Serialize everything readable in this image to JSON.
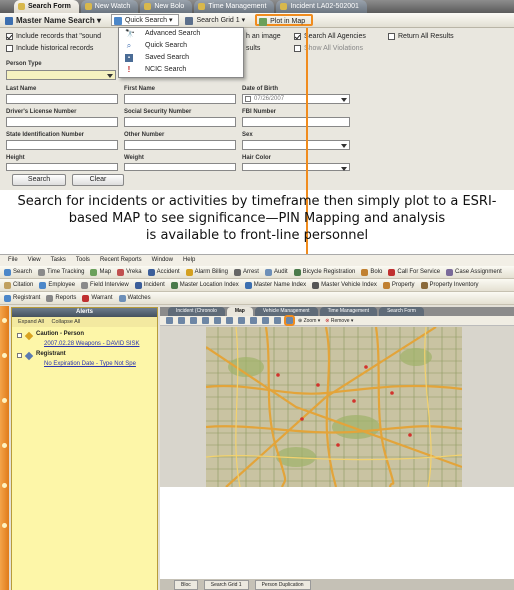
{
  "top": {
    "tabs": [
      {
        "label": "Search Form"
      },
      {
        "label": "New Watch"
      },
      {
        "label": "New Bolo"
      },
      {
        "label": "Time Management"
      },
      {
        "label": "Incident LA02-502001"
      }
    ],
    "toolbar": {
      "master_name_search": "Master Name Search",
      "quick_search": "Quick Search",
      "search_grid": "Search Grid 1",
      "plot_in_map": "Plot in Map"
    },
    "options": {
      "include_records_sound": "Include records that \"sound",
      "include_historical": "Include historical records",
      "with_image_partial": "h an image",
      "results_partial": "sults",
      "search_all_agencies": "Search All Agencies",
      "return_all_results": "Return All Results",
      "show_all_violations": "Show All Violations"
    },
    "quick_search_menu": [
      {
        "label": "Advanced Search",
        "icon": "binoculars-icon"
      },
      {
        "label": "Quick Search",
        "icon": "magnifier-icon"
      },
      {
        "label": "Saved Search",
        "icon": "save-icon"
      },
      {
        "label": "NCIC Search",
        "icon": "alert-icon"
      }
    ],
    "fields": {
      "person_type": "Person Type",
      "last_name": "Last Name",
      "first_name": "First Name",
      "date_of_birth": "Date of Birth",
      "dob_value": "07/26/2007",
      "drivers_license": "Driver's License Number",
      "ssn": "Social Security Number",
      "fbi_number": "FBI Number",
      "state_id": "State Identification Number",
      "other_number": "Other Number",
      "sex": "Sex",
      "height": "Height",
      "weight": "Weight",
      "hair_color": "Hair Color"
    },
    "buttons": {
      "search": "Search",
      "clear": "Clear"
    }
  },
  "caption": {
    "line1": "Search for incidents or activities by timeframe then simply plot to a ESRI-",
    "line2": "based MAP to see significance—PIN Mapping and analysis",
    "line3": "is available to front-line personnel"
  },
  "bottom": {
    "menubar": [
      "File",
      "View",
      "Tasks",
      "Tools",
      "Recent Reports",
      "Window",
      "Help"
    ],
    "row1": [
      "Search",
      "Time Tracking",
      "Map",
      "Vreka",
      "Accident",
      "Alarm Billing",
      "Arrest",
      "Audit",
      "Bicycle Registration",
      "Bolo",
      "Call For Service",
      "Case Assignment"
    ],
    "row2": [
      "Citation",
      "Employee",
      "Field Interview",
      "Incident",
      "Master Location Index",
      "Master Name Index",
      "Master Vehicle Index",
      "Property",
      "Property Inventory"
    ],
    "row3": [
      "Registrant",
      "Reports",
      "Warrant",
      "Watches"
    ],
    "alerts": {
      "title": "Alerts",
      "expand_all": "Expand All",
      "collapse_all": "Collapse All",
      "groups": [
        {
          "title": "Caution - Person",
          "item": "2007.02.28 Weapons - DAVID SISK"
        },
        {
          "title": "Registrant",
          "item": "No Expiration Date - Type Not Spe"
        }
      ]
    },
    "map_tabs": [
      "Incident (Chronolo",
      "Map",
      "Vehicle Management",
      "Time Management",
      "Search Form"
    ],
    "map_tools": {
      "zoom": "Zoom",
      "remove": "Remove"
    },
    "bottom_tabs": [
      "Bloc",
      "Search Grid 1",
      "Person Duplication"
    ],
    "sidebar": [
      "Action Items",
      "Alerts",
      "Incident",
      "Tasks",
      "Calendar",
      "Favorites"
    ]
  },
  "colors": {
    "accent": "#f08c1e",
    "alert_bg": "#fdf6a8",
    "sidebar": "#e07b19"
  }
}
